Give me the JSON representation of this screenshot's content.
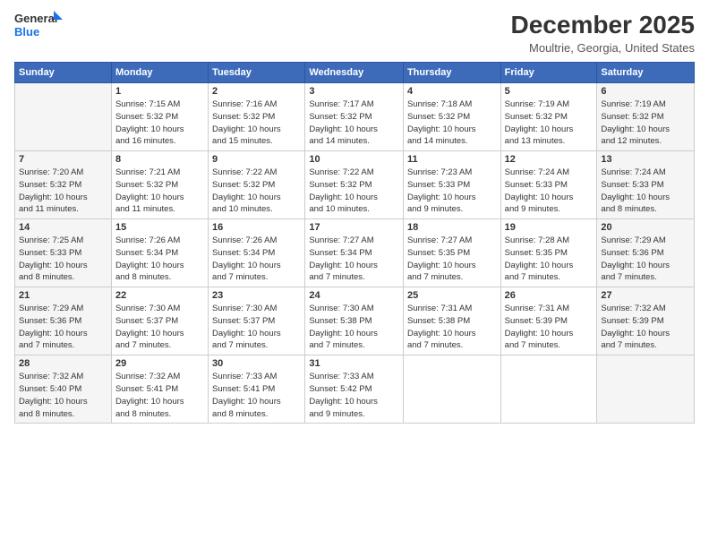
{
  "header": {
    "logo_general": "General",
    "logo_blue": "Blue",
    "title": "December 2025",
    "location": "Moultrie, Georgia, United States"
  },
  "columns": [
    "Sunday",
    "Monday",
    "Tuesday",
    "Wednesday",
    "Thursday",
    "Friday",
    "Saturday"
  ],
  "weeks": [
    [
      {
        "date": "",
        "info": ""
      },
      {
        "date": "1",
        "info": "Sunrise: 7:15 AM\nSunset: 5:32 PM\nDaylight: 10 hours\nand 16 minutes."
      },
      {
        "date": "2",
        "info": "Sunrise: 7:16 AM\nSunset: 5:32 PM\nDaylight: 10 hours\nand 15 minutes."
      },
      {
        "date": "3",
        "info": "Sunrise: 7:17 AM\nSunset: 5:32 PM\nDaylight: 10 hours\nand 14 minutes."
      },
      {
        "date": "4",
        "info": "Sunrise: 7:18 AM\nSunset: 5:32 PM\nDaylight: 10 hours\nand 14 minutes."
      },
      {
        "date": "5",
        "info": "Sunrise: 7:19 AM\nSunset: 5:32 PM\nDaylight: 10 hours\nand 13 minutes."
      },
      {
        "date": "6",
        "info": "Sunrise: 7:19 AM\nSunset: 5:32 PM\nDaylight: 10 hours\nand 12 minutes."
      }
    ],
    [
      {
        "date": "7",
        "info": "Sunrise: 7:20 AM\nSunset: 5:32 PM\nDaylight: 10 hours\nand 11 minutes."
      },
      {
        "date": "8",
        "info": "Sunrise: 7:21 AM\nSunset: 5:32 PM\nDaylight: 10 hours\nand 11 minutes."
      },
      {
        "date": "9",
        "info": "Sunrise: 7:22 AM\nSunset: 5:32 PM\nDaylight: 10 hours\nand 10 minutes."
      },
      {
        "date": "10",
        "info": "Sunrise: 7:22 AM\nSunset: 5:32 PM\nDaylight: 10 hours\nand 10 minutes."
      },
      {
        "date": "11",
        "info": "Sunrise: 7:23 AM\nSunset: 5:33 PM\nDaylight: 10 hours\nand 9 minutes."
      },
      {
        "date": "12",
        "info": "Sunrise: 7:24 AM\nSunset: 5:33 PM\nDaylight: 10 hours\nand 9 minutes."
      },
      {
        "date": "13",
        "info": "Sunrise: 7:24 AM\nSunset: 5:33 PM\nDaylight: 10 hours\nand 8 minutes."
      }
    ],
    [
      {
        "date": "14",
        "info": "Sunrise: 7:25 AM\nSunset: 5:33 PM\nDaylight: 10 hours\nand 8 minutes."
      },
      {
        "date": "15",
        "info": "Sunrise: 7:26 AM\nSunset: 5:34 PM\nDaylight: 10 hours\nand 8 minutes."
      },
      {
        "date": "16",
        "info": "Sunrise: 7:26 AM\nSunset: 5:34 PM\nDaylight: 10 hours\nand 7 minutes."
      },
      {
        "date": "17",
        "info": "Sunrise: 7:27 AM\nSunset: 5:34 PM\nDaylight: 10 hours\nand 7 minutes."
      },
      {
        "date": "18",
        "info": "Sunrise: 7:27 AM\nSunset: 5:35 PM\nDaylight: 10 hours\nand 7 minutes."
      },
      {
        "date": "19",
        "info": "Sunrise: 7:28 AM\nSunset: 5:35 PM\nDaylight: 10 hours\nand 7 minutes."
      },
      {
        "date": "20",
        "info": "Sunrise: 7:29 AM\nSunset: 5:36 PM\nDaylight: 10 hours\nand 7 minutes."
      }
    ],
    [
      {
        "date": "21",
        "info": "Sunrise: 7:29 AM\nSunset: 5:36 PM\nDaylight: 10 hours\nand 7 minutes."
      },
      {
        "date": "22",
        "info": "Sunrise: 7:30 AM\nSunset: 5:37 PM\nDaylight: 10 hours\nand 7 minutes."
      },
      {
        "date": "23",
        "info": "Sunrise: 7:30 AM\nSunset: 5:37 PM\nDaylight: 10 hours\nand 7 minutes."
      },
      {
        "date": "24",
        "info": "Sunrise: 7:30 AM\nSunset: 5:38 PM\nDaylight: 10 hours\nand 7 minutes."
      },
      {
        "date": "25",
        "info": "Sunrise: 7:31 AM\nSunset: 5:38 PM\nDaylight: 10 hours\nand 7 minutes."
      },
      {
        "date": "26",
        "info": "Sunrise: 7:31 AM\nSunset: 5:39 PM\nDaylight: 10 hours\nand 7 minutes."
      },
      {
        "date": "27",
        "info": "Sunrise: 7:32 AM\nSunset: 5:39 PM\nDaylight: 10 hours\nand 7 minutes."
      }
    ],
    [
      {
        "date": "28",
        "info": "Sunrise: 7:32 AM\nSunset: 5:40 PM\nDaylight: 10 hours\nand 8 minutes."
      },
      {
        "date": "29",
        "info": "Sunrise: 7:32 AM\nSunset: 5:41 PM\nDaylight: 10 hours\nand 8 minutes."
      },
      {
        "date": "30",
        "info": "Sunrise: 7:33 AM\nSunset: 5:41 PM\nDaylight: 10 hours\nand 8 minutes."
      },
      {
        "date": "31",
        "info": "Sunrise: 7:33 AM\nSunset: 5:42 PM\nDaylight: 10 hours\nand 9 minutes."
      },
      {
        "date": "",
        "info": ""
      },
      {
        "date": "",
        "info": ""
      },
      {
        "date": "",
        "info": ""
      }
    ]
  ]
}
